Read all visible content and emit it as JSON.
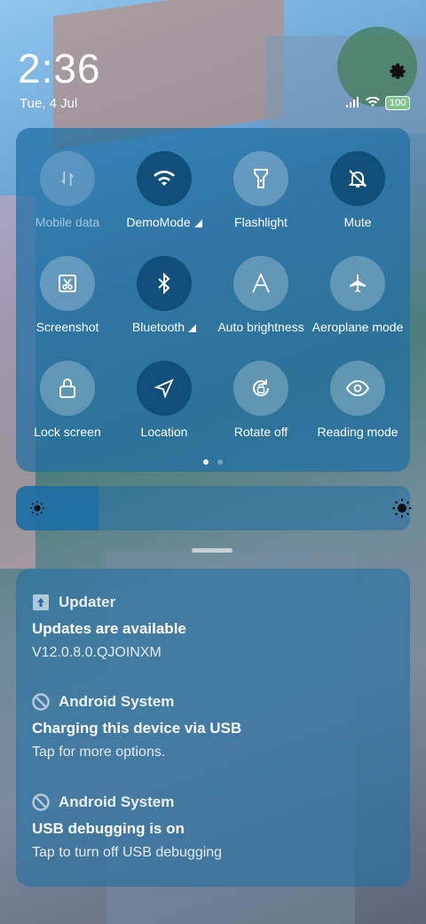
{
  "status_bar": {
    "time": "2:36",
    "date": "Tue, 4 Jul",
    "battery": "100"
  },
  "quick_settings": {
    "tiles": [
      {
        "label": "Mobile data",
        "icon": "mobile-data-icon",
        "state": "disabled",
        "has_more": false
      },
      {
        "label": "DemoMode",
        "icon": "wifi-icon",
        "state": "on",
        "has_more": true
      },
      {
        "label": "Flashlight",
        "icon": "flashlight-icon",
        "state": "off",
        "has_more": false
      },
      {
        "label": "Mute",
        "icon": "bell-off-icon",
        "state": "on",
        "has_more": false
      },
      {
        "label": "Screenshot",
        "icon": "screenshot-icon",
        "state": "off",
        "has_more": false
      },
      {
        "label": "Bluetooth",
        "icon": "bluetooth-icon",
        "state": "on",
        "has_more": true
      },
      {
        "label": "Auto brightness",
        "icon": "auto-brightness-icon",
        "state": "off",
        "has_more": false
      },
      {
        "label": "Aeroplane mode",
        "icon": "aeroplane-icon",
        "state": "off",
        "has_more": false
      },
      {
        "label": "Lock screen",
        "icon": "lock-icon",
        "state": "off",
        "has_more": false
      },
      {
        "label": "Location",
        "icon": "location-icon",
        "state": "on",
        "has_more": false
      },
      {
        "label": "Rotate off",
        "icon": "rotate-lock-icon",
        "state": "off",
        "has_more": false
      },
      {
        "label": "Reading mode",
        "icon": "eye-icon",
        "state": "off",
        "has_more": false
      }
    ],
    "page_indicator": {
      "pages": 2,
      "current": 1
    }
  },
  "brightness": {
    "level": 0.21
  },
  "notifications": [
    {
      "app": "Updater",
      "icon": "update-icon",
      "title": "Updates are available",
      "body": "V12.0.8.0.QJOINXM"
    },
    {
      "app": "Android System",
      "icon": "android-system-icon",
      "title": "Charging this device via USB",
      "body": "Tap for more options."
    },
    {
      "app": "Android System",
      "icon": "android-system-icon",
      "title": "USB debugging is on",
      "body": "Tap to turn off USB debugging"
    }
  ],
  "colors": {
    "panel": "#1f6fa3",
    "tile_on": "#0f4f7a"
  }
}
